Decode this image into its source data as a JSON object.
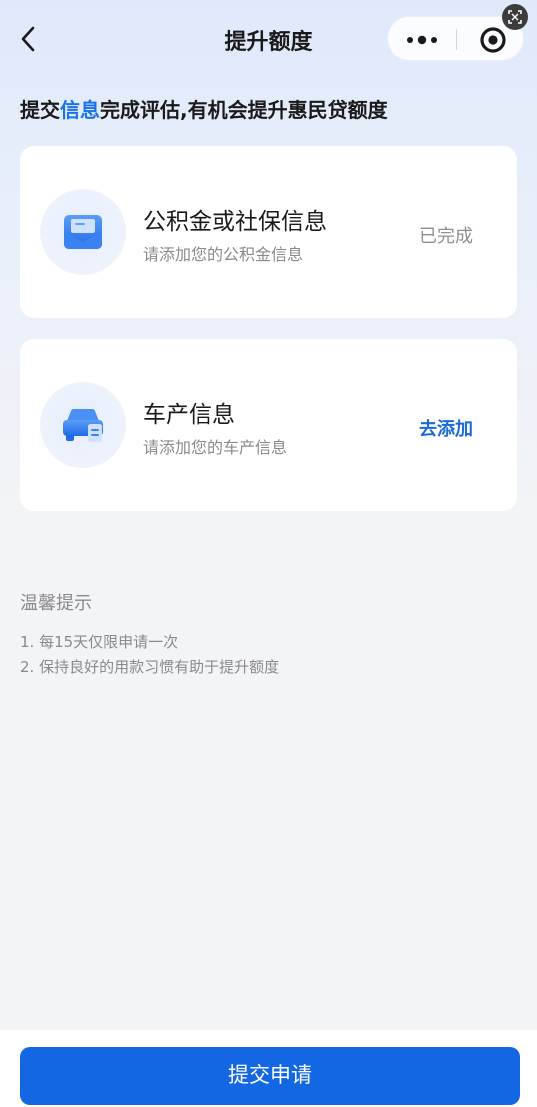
{
  "nav": {
    "title": "提升额度"
  },
  "headline": {
    "prefix": "提交",
    "highlight": "信息",
    "suffix": "完成评估,有机会提升惠民贷额度"
  },
  "cards": [
    {
      "title": "公积金或社保信息",
      "subtitle": "请添加您的公积金信息",
      "status": "已完成",
      "icon": "envelope-icon"
    },
    {
      "title": "车产信息",
      "subtitle": "请添加您的车产信息",
      "action": "去添加",
      "icon": "car-icon"
    }
  ],
  "tips": {
    "title": "温馨提示",
    "items": [
      "1. 每15天仅限申请一次",
      "2. 保持良好的用款习惯有助于提升额度"
    ]
  },
  "footer": {
    "submit_label": "提交申请"
  },
  "colors": {
    "accent": "#1467e3",
    "highlight_text": "#1a73e8",
    "muted_text": "#8a8a8a"
  }
}
